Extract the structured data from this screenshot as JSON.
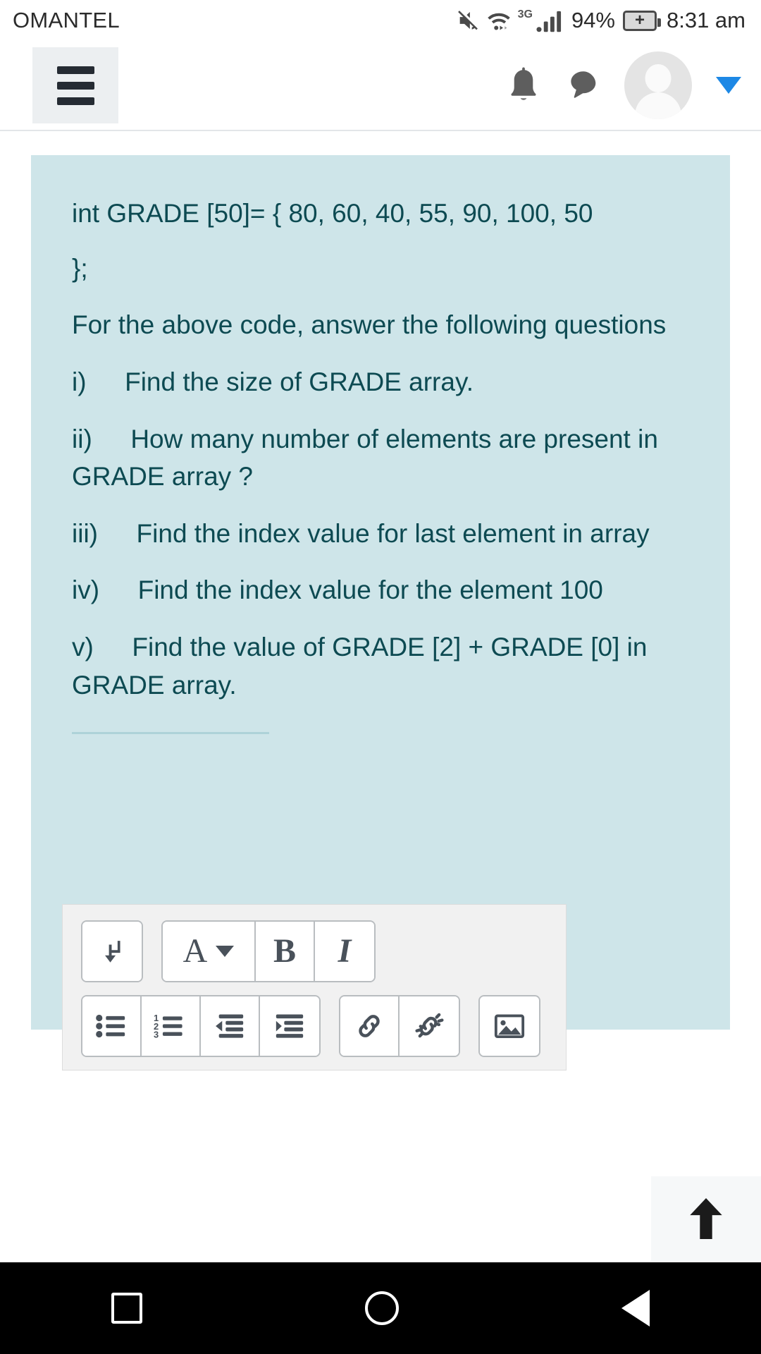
{
  "status_bar": {
    "carrier": "OMANTEL",
    "network_type": "3G",
    "battery_percent": "94%",
    "time": "8:31 am",
    "icons": [
      "mute-icon",
      "wifi-icon",
      "signal-bars-icon",
      "battery-charging-icon"
    ]
  },
  "header": {
    "menu_label": "",
    "icons": [
      "hamburger-menu-icon",
      "bell-icon",
      "chat-bubble-icon",
      "avatar-icon",
      "caret-down-icon"
    ]
  },
  "content": {
    "code_line_1": "int   GRADE [50]= { 80, 60, 40, 55, 90, 100, 50",
    "code_line_2": "};",
    "intro": "For the above code, answer the following questions",
    "questions": [
      {
        "marker": "i)",
        "text": "Find the size of GRADE array."
      },
      {
        "marker": "ii)",
        "text": "How many number of elements  are present in GRADE array ?"
      },
      {
        "marker": "iii)",
        "text": "Find the index value for last element in array"
      },
      {
        "marker": "iv)",
        "text": "Find the index value for the element 100"
      },
      {
        "marker": "v)",
        "text": "Find the value of  GRADE [2] + GRADE [0]  in GRADE array."
      }
    ]
  },
  "editor_toolbar": {
    "row1": [
      {
        "name": "line-break-button",
        "glyph": "⤵"
      },
      {
        "name": "font-style-button",
        "glyph": "A"
      },
      {
        "name": "bold-button",
        "glyph": "B"
      },
      {
        "name": "italic-button",
        "glyph": "I"
      }
    ],
    "row2": [
      {
        "name": "bullet-list-button"
      },
      {
        "name": "numbered-list-button"
      },
      {
        "name": "outdent-button"
      },
      {
        "name": "indent-button"
      },
      {
        "name": "insert-link-button"
      },
      {
        "name": "unlink-button"
      },
      {
        "name": "insert-image-button"
      }
    ],
    "list_numbers": [
      "1",
      "2",
      "3"
    ]
  },
  "scroll_top": {
    "name": "scroll-to-top-button"
  },
  "nav_bar": {
    "buttons": [
      "recents-button",
      "home-button",
      "back-button"
    ]
  },
  "colors": {
    "content_bg": "#cee5e9",
    "content_text": "#0d4a52",
    "accent_blue": "#1d88e5",
    "toolbar_bg": "#f1f1f1"
  }
}
